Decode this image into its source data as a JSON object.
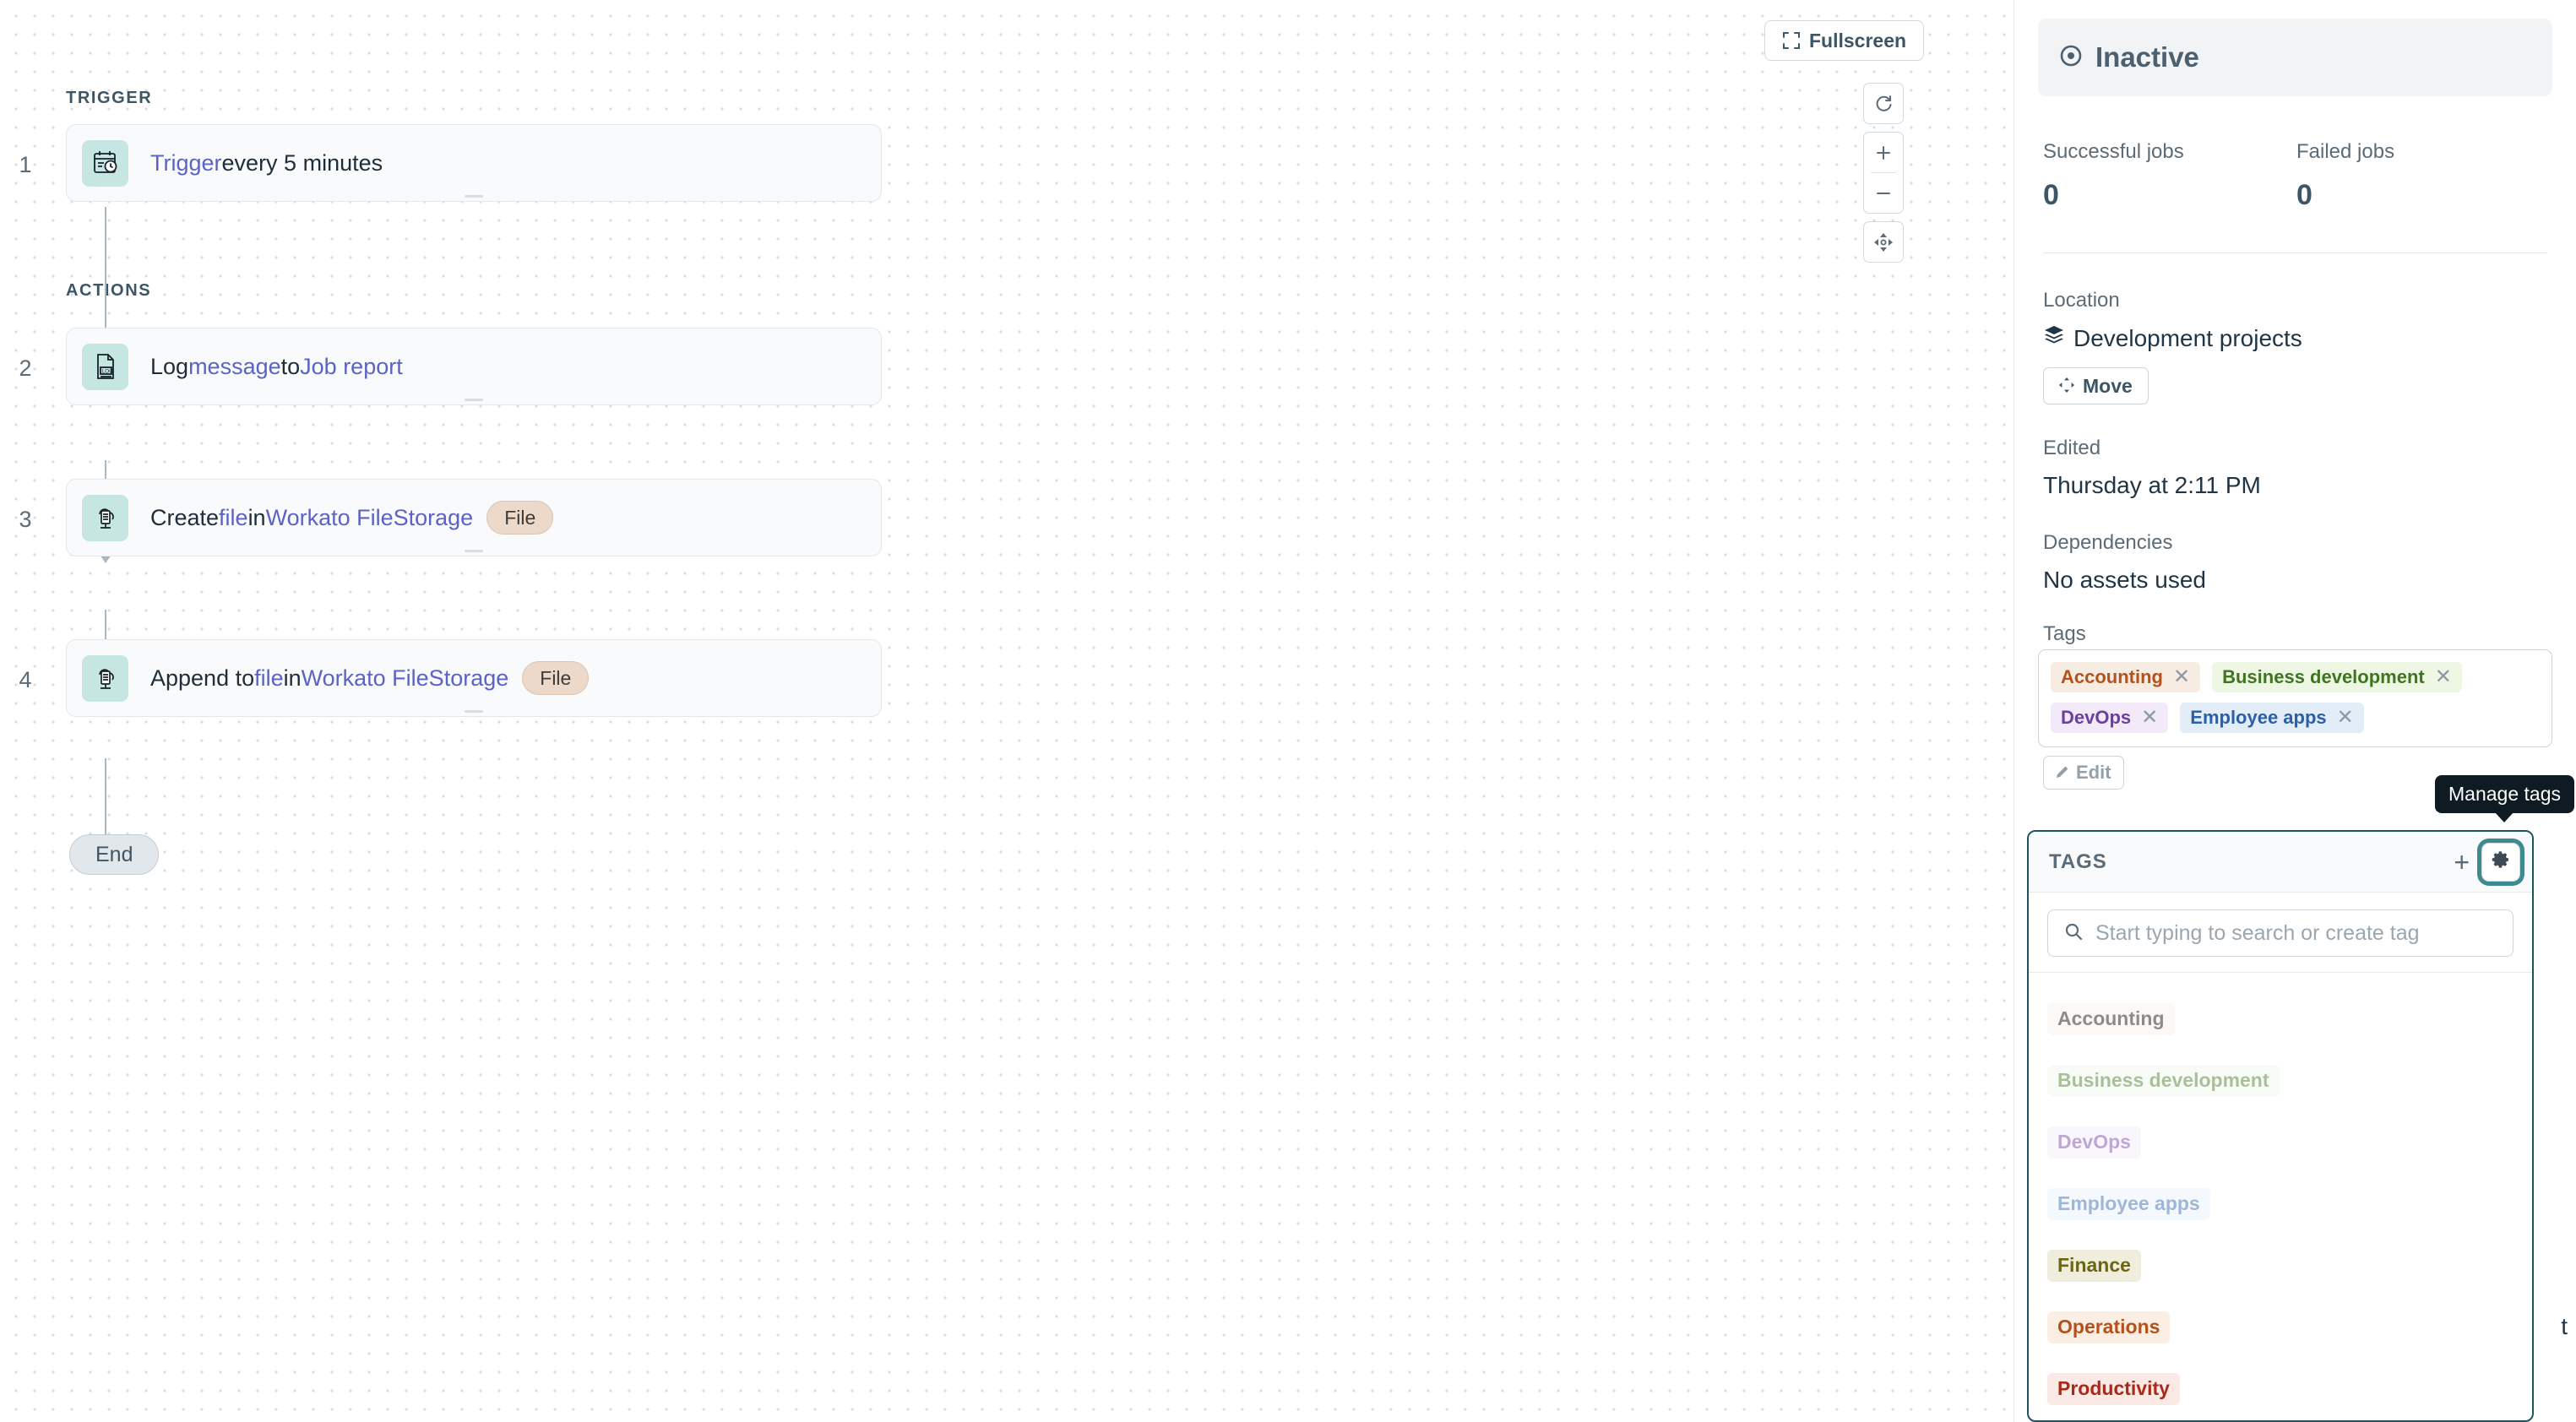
{
  "canvas": {
    "fullscreen_label": "Fullscreen",
    "trigger_section_label": "TRIGGER",
    "actions_section_label": "ACTIONS",
    "end_label": "End",
    "controls": [
      {
        "name": "reset-view",
        "glyph": "↺"
      },
      {
        "name": "zoom-in",
        "glyph": "+"
      },
      {
        "name": "zoom-out",
        "glyph": "−"
      },
      {
        "name": "fit-to-screen",
        "glyph": "✥"
      }
    ],
    "steps": [
      {
        "number": "1",
        "icon": "schedule-clock-icon",
        "parts": [
          {
            "text": "Trigger",
            "link": true
          },
          {
            "text": " every 5 minutes",
            "link": false
          }
        ],
        "pill": ""
      },
      {
        "number": "2",
        "icon": "log-file-icon",
        "parts": [
          {
            "text": "Log ",
            "link": false
          },
          {
            "text": "message",
            "link": true
          },
          {
            "text": " to ",
            "link": false
          },
          {
            "text": "Job report",
            "link": true
          }
        ],
        "pill": ""
      },
      {
        "number": "3",
        "icon": "cloud-file-icon",
        "parts": [
          {
            "text": "Create ",
            "link": false
          },
          {
            "text": "file",
            "link": true
          },
          {
            "text": " in ",
            "link": false
          },
          {
            "text": "Workato FileStorage",
            "link": true
          }
        ],
        "pill": "File"
      },
      {
        "number": "4",
        "icon": "cloud-file-icon",
        "parts": [
          {
            "text": "Append to ",
            "link": false
          },
          {
            "text": "file",
            "link": true
          },
          {
            "text": " in ",
            "link": false
          },
          {
            "text": "Workato FileStorage",
            "link": true
          }
        ],
        "pill": "File"
      }
    ]
  },
  "panel": {
    "status": {
      "icon": "inactive-target-icon",
      "label": "Inactive"
    },
    "jobs": [
      {
        "label": "Successful jobs",
        "value": "0"
      },
      {
        "label": "Failed jobs",
        "value": "0"
      }
    ],
    "location": {
      "label": "Location",
      "value": "Development projects",
      "icon": "layers-icon",
      "move_label": "Move"
    },
    "edited": {
      "label": "Edited",
      "value": "Thursday at 2:11 PM"
    },
    "dependencies": {
      "label": "Dependencies",
      "value": "No assets used"
    },
    "tags": {
      "label": "Tags",
      "edit_label": "Edit",
      "chips": [
        {
          "name": "Accounting",
          "bg": "#f7ece1",
          "fg": "#b4521f"
        },
        {
          "name": "Business development",
          "bg": "#eef6e4",
          "fg": "#3f7521"
        },
        {
          "name": "DevOps",
          "bg": "#f2eaf8",
          "fg": "#6c3fa0"
        },
        {
          "name": "Employee apps",
          "bg": "#e3edf8",
          "fg": "#2b5fa8"
        }
      ]
    },
    "hidden_text_fragment": "t"
  },
  "tooltip": {
    "text": "Manage tags"
  },
  "dropdown": {
    "title": "TAGS",
    "add_glyph": "+",
    "gear_icon": "gear-icon",
    "search": {
      "placeholder": "Start typing to search or create tag",
      "value": "",
      "icon": "search-icon"
    },
    "items": [
      {
        "name": "Accounting",
        "bg": "#f9f1e9",
        "fg": "#c2norm",
        "selected": true
      },
      {
        "name": "Business development",
        "bg": "#f3f8ec",
        "fg": "#3f7521",
        "selected": true
      },
      {
        "name": "DevOps",
        "bg": "#f5eefa",
        "fg": "#6c3fa0",
        "selected": true
      },
      {
        "name": "Employee apps",
        "bg": "#eaf1fa",
        "fg": "#2b5fa8",
        "selected": true
      },
      {
        "name": "Finance",
        "bg": "#efeedc",
        "fg": "#6e6416",
        "selected": false
      },
      {
        "name": "Operations",
        "bg": "#fbeee3",
        "fg": "#b4521f",
        "selected": false
      },
      {
        "name": "Productivity",
        "bg": "#fbe9e6",
        "fg": "#a9291b",
        "selected": false
      }
    ]
  }
}
